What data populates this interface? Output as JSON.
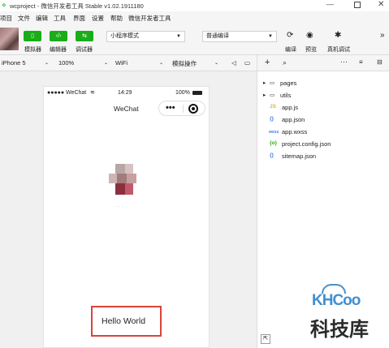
{
  "window": {
    "title": "wcproject - 微信开发者工具 Stable v1.02.1911180"
  },
  "menu": {
    "items": [
      "项目",
      "文件",
      "编辑",
      "工具",
      "界面",
      "设置",
      "帮助",
      "微信开发者工具"
    ]
  },
  "toolbar": {
    "simulator_label": "模拟器",
    "editor_label": "编辑器",
    "debugger_label": "调试器",
    "mode_select": "小程序模式",
    "compile_select": "普通编译",
    "compile_label": "编译",
    "preview_label": "预览",
    "remote_debug_label": "真机调试",
    "more": "»"
  },
  "device_bar": {
    "device": "iPhone 5",
    "zoom": "100%",
    "network": "WiFi",
    "simulate": "模拟操作"
  },
  "phone": {
    "carrier": "●●●●● WeChat",
    "time": "14:29",
    "battery": "100%",
    "nav_title": "WeChat",
    "capsule_dots": "•••",
    "hello": "Hello World",
    "nickname": "· · ·"
  },
  "files": [
    {
      "name": "pages",
      "type": "folder"
    },
    {
      "name": "utils",
      "type": "folder"
    },
    {
      "name": "app.js",
      "type": "js"
    },
    {
      "name": "app.json",
      "type": "json"
    },
    {
      "name": "app.wxss",
      "type": "wxss"
    },
    {
      "name": "project.config.json",
      "type": "config"
    },
    {
      "name": "sitemap.json",
      "type": "json"
    }
  ],
  "watermark": {
    "brand": "KHCoo",
    "cn": "科技库"
  },
  "colors": {
    "accent": "#1aad19",
    "highlight_border": "#d9443b"
  }
}
